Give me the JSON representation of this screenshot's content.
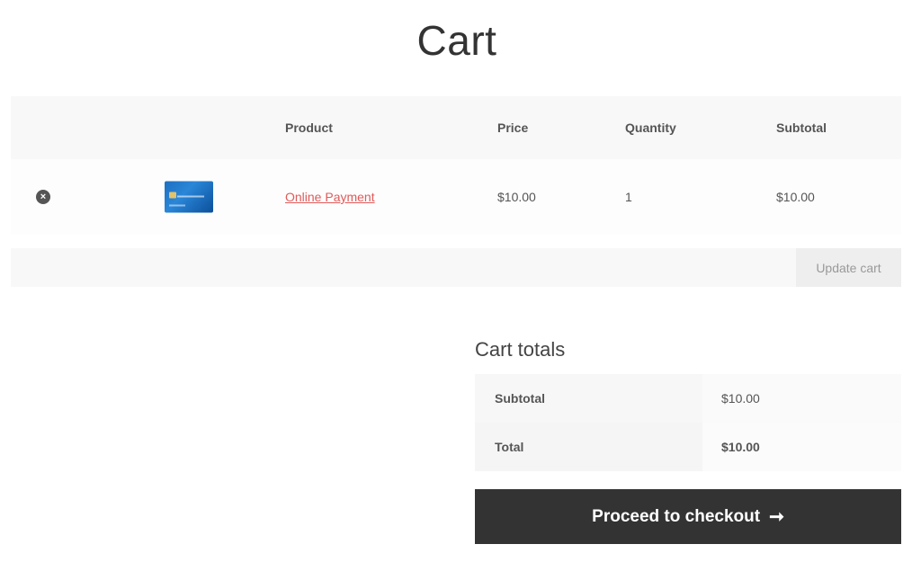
{
  "page": {
    "title": "Cart"
  },
  "cart": {
    "headers": {
      "product": "Product",
      "price": "Price",
      "quantity": "Quantity",
      "subtotal": "Subtotal"
    },
    "items": [
      {
        "remove_icon": "remove-circle-icon",
        "remove_glyph": "×",
        "thumbnail": "credit-card-image",
        "name": "Online Payment",
        "price": "$10.00",
        "quantity": "1",
        "subtotal": "$10.00"
      }
    ],
    "update_label": "Update cart"
  },
  "totals": {
    "title": "Cart totals",
    "subtotal_label": "Subtotal",
    "subtotal_value": "$10.00",
    "total_label": "Total",
    "total_value": "$10.00"
  },
  "checkout": {
    "label": "Proceed to checkout",
    "icon": "arrow-right-icon",
    "glyph": "➞"
  },
  "colors": {
    "link": "#e05a5a",
    "checkout_bg": "#333333"
  }
}
